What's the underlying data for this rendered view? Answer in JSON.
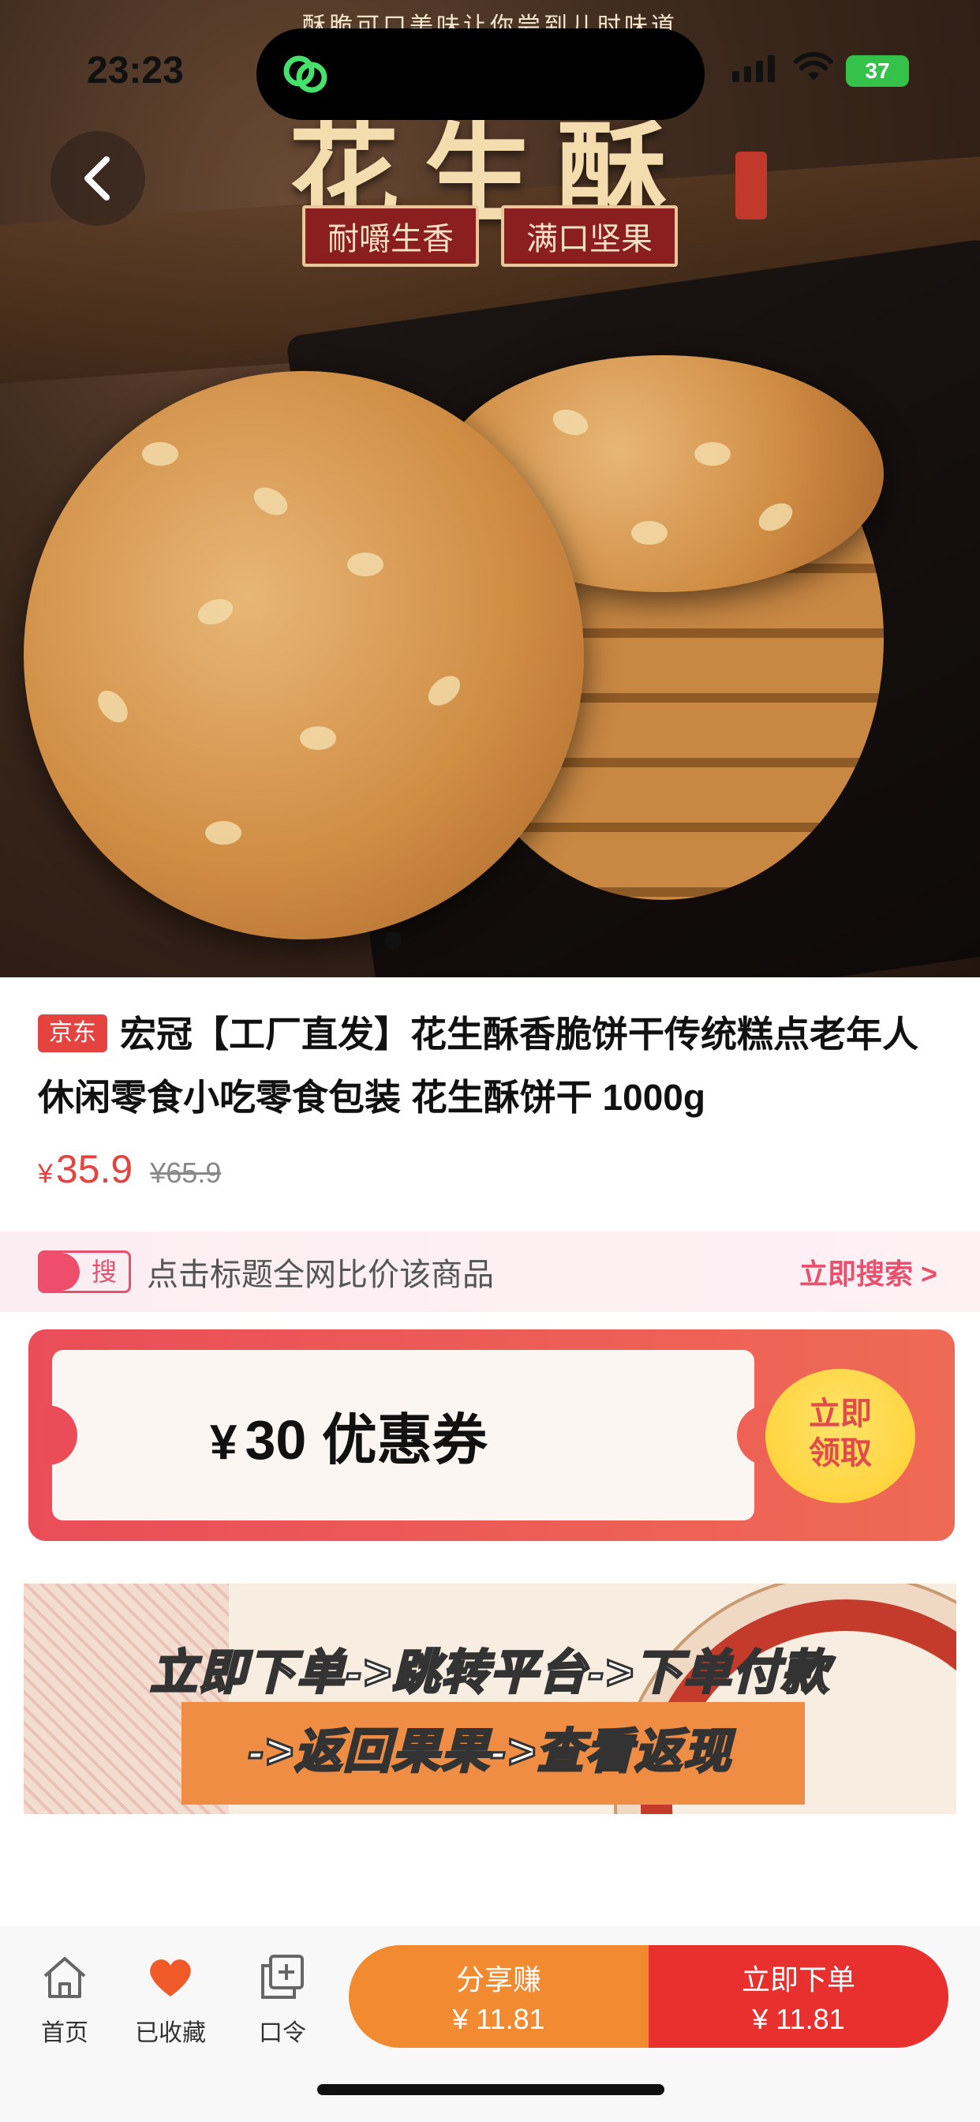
{
  "status_bar": {
    "time": "23:23",
    "battery": "37"
  },
  "hero": {
    "tagline": "酥脆可口美味让你尝到儿时味道",
    "title": "花生酥",
    "tags": [
      "耐嚼生香",
      "满口坚果"
    ]
  },
  "product": {
    "platform_badge": "京东",
    "title": "宏冠【工厂直发】花生酥香脆饼干传统糕点老年人休闲零食小吃零食包装 花生酥饼干 1000g",
    "price_currency": "¥",
    "price": "35.9",
    "original_price": "¥65.9"
  },
  "search_compare": {
    "tag": "搜",
    "text": "点击标题全网比价该商品",
    "action": "立即搜索 >"
  },
  "coupon": {
    "currency": "¥",
    "amount": "30 优惠券",
    "button_line1": "立即",
    "button_line2": "领取"
  },
  "banner": {
    "line1": "立即下单->跳转平台->下单付款",
    "line2": "->返回果果->查看返现"
  },
  "bottom_bar": {
    "tabs": [
      {
        "label": "首页",
        "icon": "home-icon"
      },
      {
        "label": "已收藏",
        "icon": "heart-icon"
      },
      {
        "label": "口令",
        "icon": "copy-plus-icon"
      }
    ],
    "share": {
      "label": "分享赚",
      "value": "¥ 11.81"
    },
    "buy": {
      "label": "立即下单",
      "value": "¥ 11.81"
    }
  },
  "colors": {
    "accent_red": "#e5433f",
    "orange": "#f28a32",
    "pink": "#e8506e",
    "coupon_yellow": "#ffd23a"
  }
}
